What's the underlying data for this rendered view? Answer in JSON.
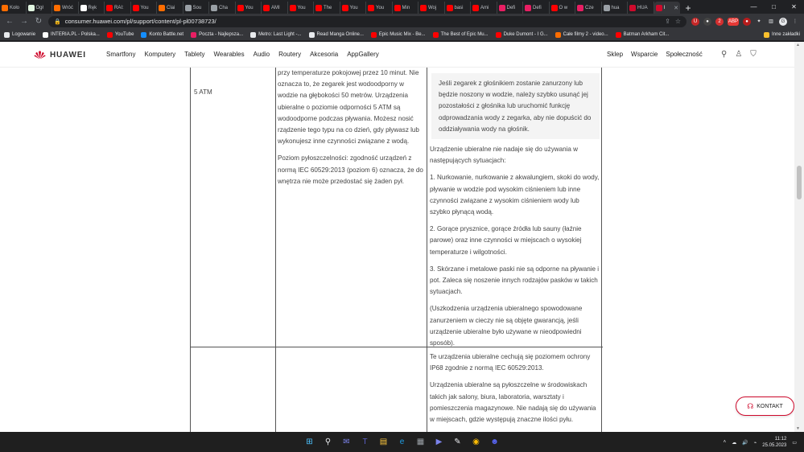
{
  "browser": {
    "tabs": [
      {
        "label": "Koło",
        "color": "#ff6d00"
      },
      {
        "label": "Ogł",
        "color": "#e1f5e1"
      },
      {
        "label": "Wróć",
        "color": "#ff6d00"
      },
      {
        "label": "Ręk",
        "color": "#ffffff"
      },
      {
        "label": "RAI:",
        "color": "#ff0000"
      },
      {
        "label": "You",
        "color": "#ff0000"
      },
      {
        "label": "Clai",
        "color": "#ff6d00"
      },
      {
        "label": "Sou",
        "color": "#9aa0a6"
      },
      {
        "label": "Cha",
        "color": "#9aa0a6"
      },
      {
        "label": "You",
        "color": "#ff0000"
      },
      {
        "label": "AMI",
        "color": "#ff0000"
      },
      {
        "label": "You",
        "color": "#ff0000"
      },
      {
        "label": "The",
        "color": "#ff0000"
      },
      {
        "label": "You",
        "color": "#ff0000"
      },
      {
        "label": "You",
        "color": "#ff0000"
      },
      {
        "label": "Min",
        "color": "#ff0000"
      },
      {
        "label": "Woj",
        "color": "#ff0000"
      },
      {
        "label": "basi",
        "color": "#ff0000"
      },
      {
        "label": "Ami",
        "color": "#ff0000"
      },
      {
        "label": "Defi",
        "color": "#e91e63"
      },
      {
        "label": "Defi",
        "color": "#e91e63"
      },
      {
        "label": "O w",
        "color": "#ff0000"
      },
      {
        "label": "Cze",
        "color": "#e91e63"
      },
      {
        "label": "hua",
        "color": "#9aa0a6"
      },
      {
        "label": "HUA",
        "color": "#cf0a2c"
      },
      {
        "label": "I",
        "color": "#cf0a2c",
        "active": true
      }
    ],
    "url": "consumer.huawei.com/pl/support/content/pl-pl00738723/",
    "bookmarks": [
      {
        "label": "Logowanie",
        "color": "#e8eaed"
      },
      {
        "label": "INTERIA.PL - Polska...",
        "color": "#ffffff"
      },
      {
        "label": "YouTube",
        "color": "#ff0000"
      },
      {
        "label": "Konto Battle.net",
        "color": "#148eff"
      },
      {
        "label": "Poczta - Najlepsza...",
        "color": "#e91e63"
      },
      {
        "label": "Metro: Last Light -...",
        "color": "#e8eaed"
      },
      {
        "label": "Read Manga Online...",
        "color": "#e8eaed"
      },
      {
        "label": "Epic Music Mix - Be...",
        "color": "#ff0000"
      },
      {
        "label": "The Best of Epic Mu...",
        "color": "#ff0000"
      },
      {
        "label": "Duke Dumont - I G...",
        "color": "#ff0000"
      },
      {
        "label": "Całe filmy 2 - video...",
        "color": "#ff6d00"
      },
      {
        "label": "Batman Arkham Cit...",
        "color": "#ff0000"
      }
    ],
    "other_bookmarks": "Inne zakładki"
  },
  "site": {
    "brand": "HUAWEI",
    "menu": [
      "Smartfony",
      "Komputery",
      "Tablety",
      "Wearables",
      "Audio",
      "Routery",
      "Akcesoria",
      "AppGallery"
    ],
    "right_menu": [
      "Sklep",
      "Wsparcie",
      "Społeczność"
    ]
  },
  "table": {
    "row1_label": "5 ATM",
    "row1_description": [
      "przy temperaturze pokojowej przez 10 minut. Nie oznacza to, że zegarek jest wodoodporny w wodzie na głębokości 50 metrów. Urządzenia ubieralne o poziomie odporności 5 ATM są wodoodporne podczas pływania. Możesz nosić rządzenie tego typu na co dzień, gdy pływasz lub wykonujesz inne czynności związane z wodą.",
      "Poziom pyłoszczelności: zgodność urządzeń z normą IEC 60529:2013 (poziom 6) oznacza, że do wnętrza nie może przedostać się żaden pył."
    ],
    "note": "Jeśli zegarek z głośnikiem zostanie zanurzony lub będzie noszony w wodzie, należy szybko usunąć jej pozostałości z głośnika lub uruchomić funkcję odprowadzania wody z zegarka, aby nie dopuścić do oddziaływania wody na głośnik.",
    "row1_usage": [
      "Urządzenie ubieralne nie nadaje się do używania w następujących sytuacjach:",
      "1. Nurkowanie, nurkowanie z akwalungiem, skoki do wody, pływanie w wodzie pod wysokim ciśnieniem lub inne czynności związane z wysokim ciśnieniem wody lub szybko płynącą wodą.",
      "2. Gorące prysznice, gorące źródła lub sauny (łaźnie parowe) oraz inne czynności w miejscach o wysokiej temperaturze i wilgotności.",
      "3. Skórzane i metalowe paski nie są odporne na pływanie i pot. Zaleca się noszenie innych rodzajów pasków w takich sytuacjach.",
      "(Uszkodzenia urządzenia ubieralnego spowodowane zanurzeniem w cieczy nie są objęte gwarancją, jeśli urządzenie ubieralne było używane w nieodpowiedni sposób)."
    ],
    "row2_usage": [
      "Te urządzenia ubieralne cechują się poziomem ochrony IP68 zgodnie z normą IEC 60529:2013.",
      "Urządzenia ubieralne są pyłoszczelne w środowiskach takich jak salony, biura, laboratoria, warsztaty i pomieszczenia magazynowe. Nie nadają się do używania w miejscach, gdzie występują znaczne ilości pyłu."
    ]
  },
  "contact_button": "KONTAKT",
  "taskbar": {
    "time": "11:12",
    "date": "25.05.2023",
    "apps": [
      {
        "name": "windows-start",
        "color": "#4cc2ff"
      },
      {
        "name": "search",
        "color": "#e8eaed"
      },
      {
        "name": "chat",
        "color": "#7b83eb"
      },
      {
        "name": "teams",
        "color": "#5b5fc7"
      },
      {
        "name": "explorer",
        "color": "#ffc83d"
      },
      {
        "name": "edge",
        "color": "#1fa1e8"
      },
      {
        "name": "store",
        "color": "#9aa0a6"
      },
      {
        "name": "media-player",
        "color": "#7b83eb"
      },
      {
        "name": "tool",
        "color": "#e8eaed"
      },
      {
        "name": "chrome",
        "color": "#fbbc04"
      },
      {
        "name": "discord",
        "color": "#5865f2"
      }
    ]
  }
}
